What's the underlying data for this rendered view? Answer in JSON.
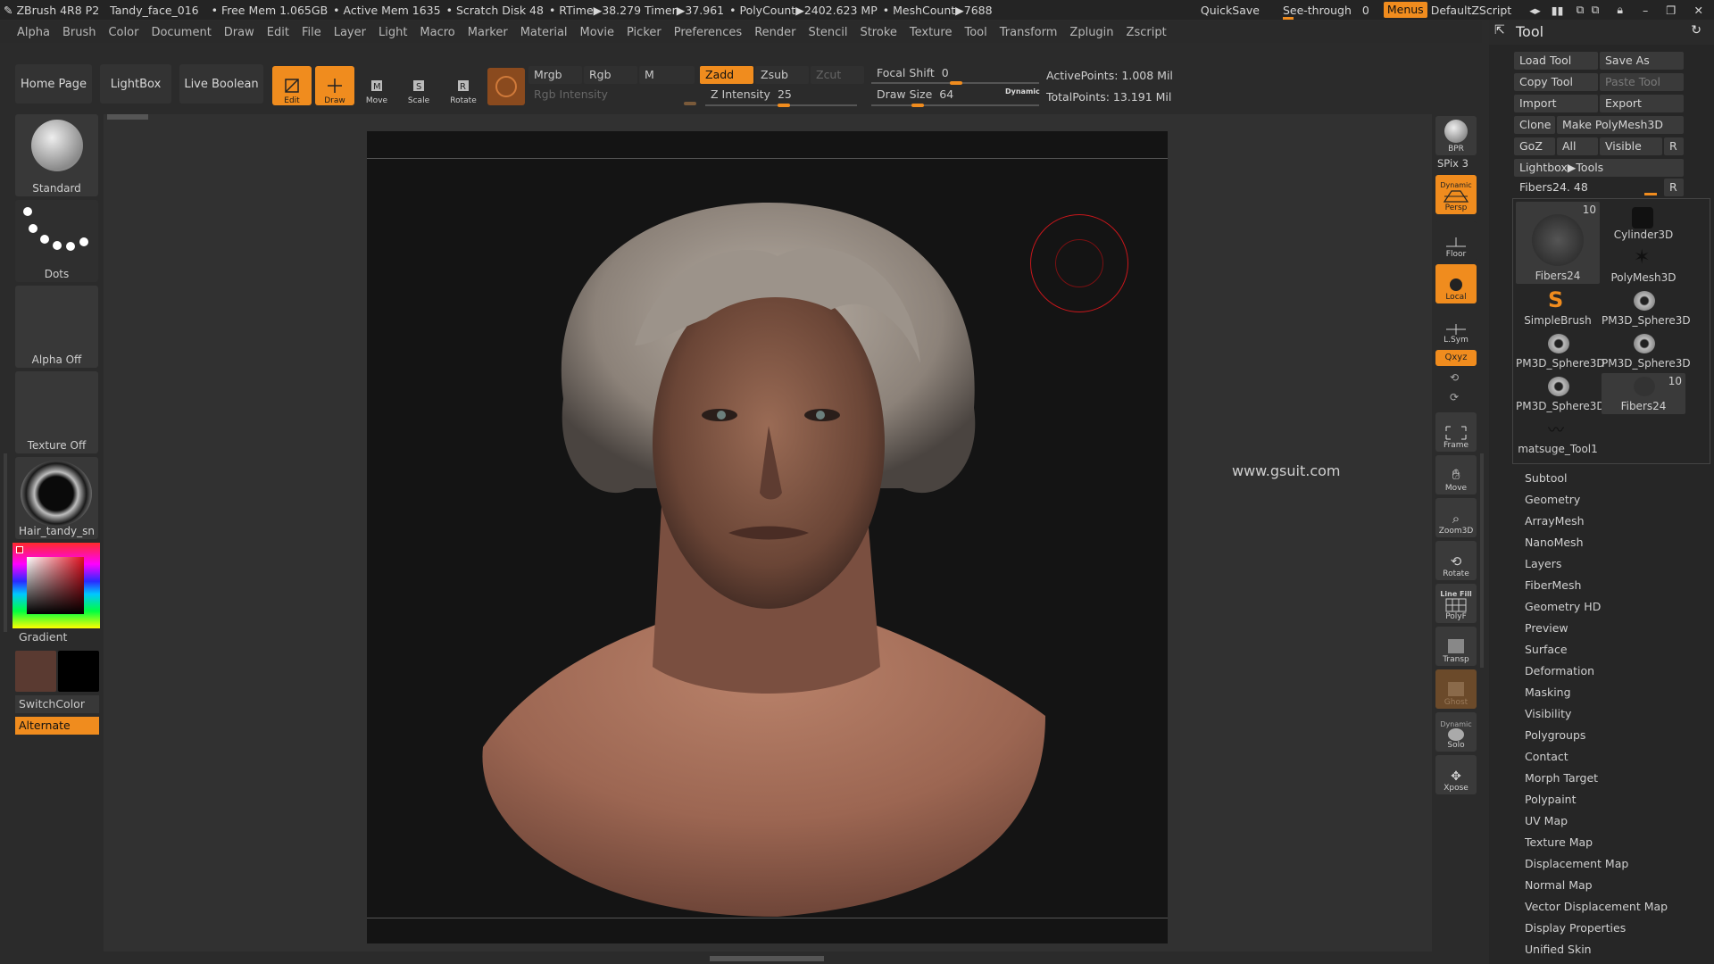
{
  "titlebar": {
    "app": "ZBrush 4R8 P2",
    "doc": "Tandy_face_016",
    "free_mem": "• Free Mem 1.065GB",
    "active_mem": "• Active Mem 1635",
    "scratch": "• Scratch Disk 48",
    "rtime": "• RTime▶38.279",
    "timer": "Timer▶37.961",
    "polycount": "• PolyCount▶2402.623 MP",
    "meshcount": "• MeshCount▶7688",
    "quicksave": "QuickSave",
    "seethrough": "See-through",
    "seethrough_val": "0",
    "menus": "Menus",
    "script": "DefaultZScript"
  },
  "menubar": [
    "Alpha",
    "Brush",
    "Color",
    "Document",
    "Draw",
    "Edit",
    "File",
    "Layer",
    "Light",
    "Macro",
    "Marker",
    "Material",
    "Movie",
    "Picker",
    "Preferences",
    "Render",
    "Stencil",
    "Stroke",
    "Texture",
    "Tool",
    "Transform",
    "Zplugin",
    "Zscript"
  ],
  "toolbar": {
    "home_page": "Home Page",
    "lightbox": "LightBox",
    "live_boolean": "Live Boolean",
    "edit": "Edit",
    "draw": "Draw",
    "move": "Move",
    "scale": "Scale",
    "rotate": "Rotate",
    "mrgb": "Mrgb",
    "rgb": "Rgb",
    "m": "M",
    "rgb_intensity": "Rgb Intensity",
    "zadd": "Zadd",
    "zsub": "Zsub",
    "zcut": "Zcut",
    "z_intensity_label": "Z Intensity",
    "z_intensity": "25",
    "focal_shift_label": "Focal Shift",
    "focal_shift": "0",
    "draw_size_label": "Draw Size",
    "draw_size": "64",
    "dynamic": "Dynamic",
    "active_points": "ActivePoints: 1.008 Mil",
    "total_points": "TotalPoints: 13.191 Mil"
  },
  "left_shelf": {
    "brush": "Standard",
    "stroke": "Dots",
    "alpha": "Alpha Off",
    "texture": "Texture Off",
    "material": "Hair_tandy_sn",
    "gradient": "Gradient",
    "switchcolor": "SwitchColor",
    "alternate": "Alternate",
    "color_main": "#5a3a31",
    "color_secondary": "#000000"
  },
  "canvas": {
    "watermark": "www.gsuit.com"
  },
  "right_shelf": {
    "bpr": "BPR",
    "spix_label": "SPix",
    "spix": "3",
    "dynamic": "Dynamic",
    "persp": "Persp",
    "floor": "Floor",
    "local": "Local",
    "lsym": "L.Sym",
    "xyz": "Qxyz",
    "frame": "Frame",
    "move": "Move",
    "zoom3d": "Zoom3D",
    "rotate": "Rotate",
    "line_fill": "Line Fill",
    "polyf": "PolyF",
    "transp": "Transp",
    "ghost": "Ghost",
    "solo": "Solo",
    "xpose": "Xpose"
  },
  "tool_palette": {
    "title": "Tool",
    "load_tool": "Load Tool",
    "save_as": "Save As",
    "copy_tool": "Copy Tool",
    "paste_tool": "Paste Tool",
    "import": "Import",
    "export": "Export",
    "clone": "Clone",
    "make_polymesh": "Make PolyMesh3D",
    "goz": "GoZ",
    "all": "All",
    "visible": "Visible",
    "r": "R",
    "lightbox_tools": "Lightbox▶Tools",
    "current_tool_label": "Fibers24.",
    "current_tool_val": "48",
    "tiles": [
      {
        "name": "Fibers24",
        "count": "10"
      },
      {
        "name": "Cylinder3D",
        "count": ""
      },
      {
        "name": "PolyMesh3D",
        "count": ""
      },
      {
        "name": "SimpleBrush",
        "count": ""
      },
      {
        "name": "PM3D_Sphere3D",
        "count": ""
      },
      {
        "name": "PM3D_Sphere3D",
        "count": ""
      },
      {
        "name": "PM3D_Sphere3D",
        "count": ""
      },
      {
        "name": "PM3D_Sphere3D",
        "count": ""
      },
      {
        "name": "Fibers24",
        "count": "10"
      },
      {
        "name": "matsuge_Tool1",
        "count": ""
      }
    ],
    "sections": [
      "Subtool",
      "Geometry",
      "ArrayMesh",
      "NanoMesh",
      "Layers",
      "FiberMesh",
      "Geometry HD",
      "Preview",
      "Surface",
      "Deformation",
      "Masking",
      "Visibility",
      "Polygroups",
      "Contact",
      "Morph Target",
      "Polypaint",
      "UV Map",
      "Texture Map",
      "Displacement Map",
      "Normal Map",
      "Vector Displacement Map",
      "Display Properties",
      "Unified Skin"
    ]
  },
  "colors": {
    "accent": "#f08c1e",
    "bg": "#2b2b2b",
    "canvas": "#141414",
    "cursor_ring": "#c8161b"
  }
}
